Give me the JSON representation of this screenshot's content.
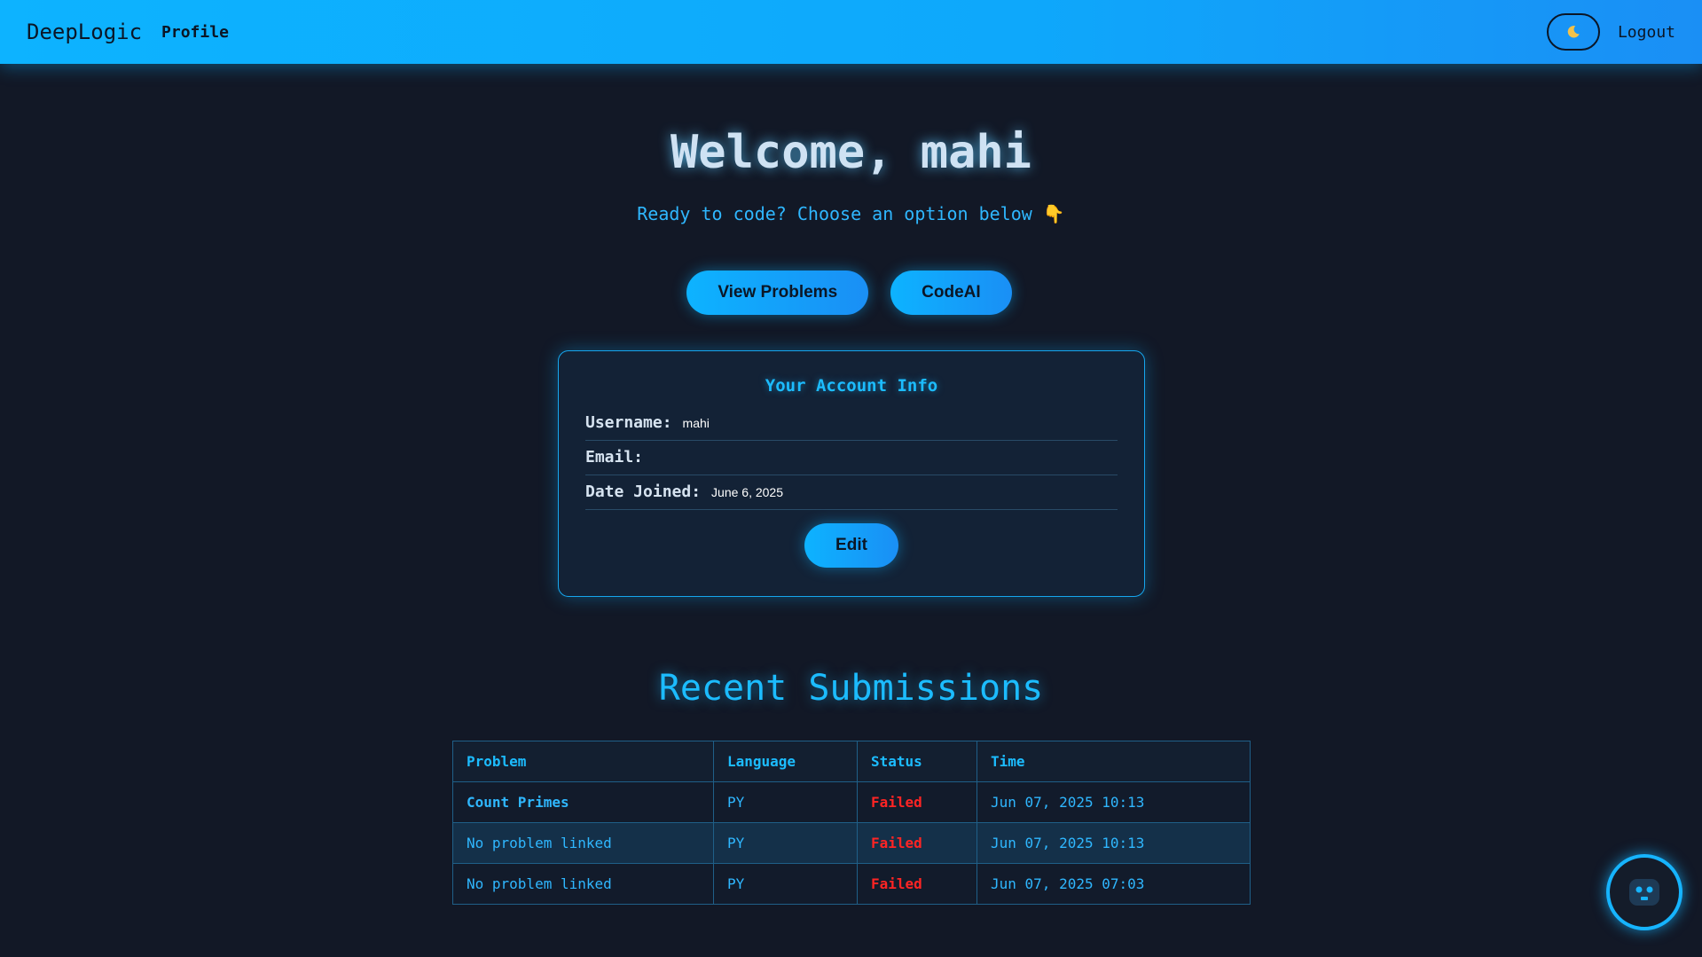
{
  "header": {
    "brand": "DeepLogic",
    "nav_profile": "Profile",
    "theme_toggle_icon": "moon-icon",
    "logout": "Logout"
  },
  "hero": {
    "title": "Welcome, mahi",
    "subtitle": "Ready to code? Choose an option below 👇",
    "buttons": {
      "view_problems": "View Problems",
      "code_ai": "CodeAI"
    }
  },
  "account": {
    "title": "Your Account Info",
    "username_label": "Username:",
    "username_value": "mahi",
    "email_label": "Email:",
    "email_value": "",
    "date_joined_label": "Date Joined:",
    "date_joined_value": "June 6, 2025",
    "edit_label": "Edit"
  },
  "submissions": {
    "title": "Recent Submissions",
    "columns": [
      "Problem",
      "Language",
      "Status",
      "Time"
    ],
    "rows": [
      {
        "problem": "Count Primes",
        "language": "PY",
        "status": "Failed",
        "time": "Jun 07, 2025 10:13"
      },
      {
        "problem": "No problem linked",
        "language": "PY",
        "status": "Failed",
        "time": "Jun 07, 2025 10:13"
      },
      {
        "problem": "No problem linked",
        "language": "PY",
        "status": "Failed",
        "time": "Jun 07, 2025 07:03"
      }
    ]
  },
  "fab": {
    "icon": "robot-icon"
  },
  "colors": {
    "accent": "#0db3ff",
    "background": "#121826",
    "status_failed": "#ff2424"
  }
}
